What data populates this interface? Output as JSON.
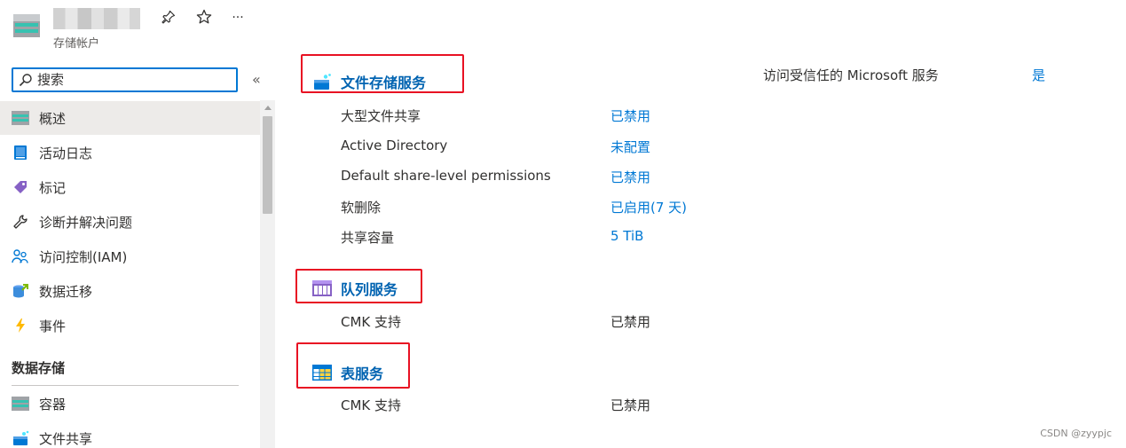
{
  "header": {
    "subtitle": "存储帐户",
    "pin_label": "Pin",
    "favorite_label": "Favorite",
    "more_label": "..."
  },
  "sidebar": {
    "search_placeholder": "搜索",
    "collapse_glyph": "«",
    "items": [
      {
        "label": "概述",
        "icon": "storage-overview-icon"
      },
      {
        "label": "活动日志",
        "icon": "activity-log-icon"
      },
      {
        "label": "标记",
        "icon": "tag-icon"
      },
      {
        "label": "诊断并解决问题",
        "icon": "wrench-icon"
      },
      {
        "label": "访问控制(IAM)",
        "icon": "people-icon"
      },
      {
        "label": "数据迁移",
        "icon": "data-migration-icon"
      },
      {
        "label": "事件",
        "icon": "lightning-icon"
      }
    ],
    "section_data_storage": "数据存储",
    "storage_items": [
      {
        "label": "容器",
        "icon": "container-icon"
      },
      {
        "label": "文件共享",
        "icon": "file-share-icon"
      }
    ]
  },
  "main": {
    "trusted_label": "访问受信任的 Microsoft 服务",
    "trusted_value": "是",
    "file_service": {
      "title": "文件存储服务",
      "props": [
        {
          "label": "大型文件共享",
          "value": "已禁用"
        },
        {
          "label": "Active Directory",
          "value": "未配置"
        },
        {
          "label": "Default share-level permissions",
          "value": "已禁用"
        },
        {
          "label": "软删除",
          "value": "已启用(7 天)"
        },
        {
          "label": "共享容量",
          "value": "5 TiB"
        }
      ]
    },
    "queue_service": {
      "title": "队列服务",
      "props": [
        {
          "label": "CMK 支持",
          "value": "已禁用"
        }
      ]
    },
    "table_service": {
      "title": "表服务",
      "props": [
        {
          "label": "CMK 支持",
          "value": "已禁用"
        }
      ]
    }
  },
  "watermark": "CSDN @zyypjc",
  "colors": {
    "accent": "#0078d4",
    "highlight_box": "#e81123",
    "active_bg": "#edebe9"
  }
}
